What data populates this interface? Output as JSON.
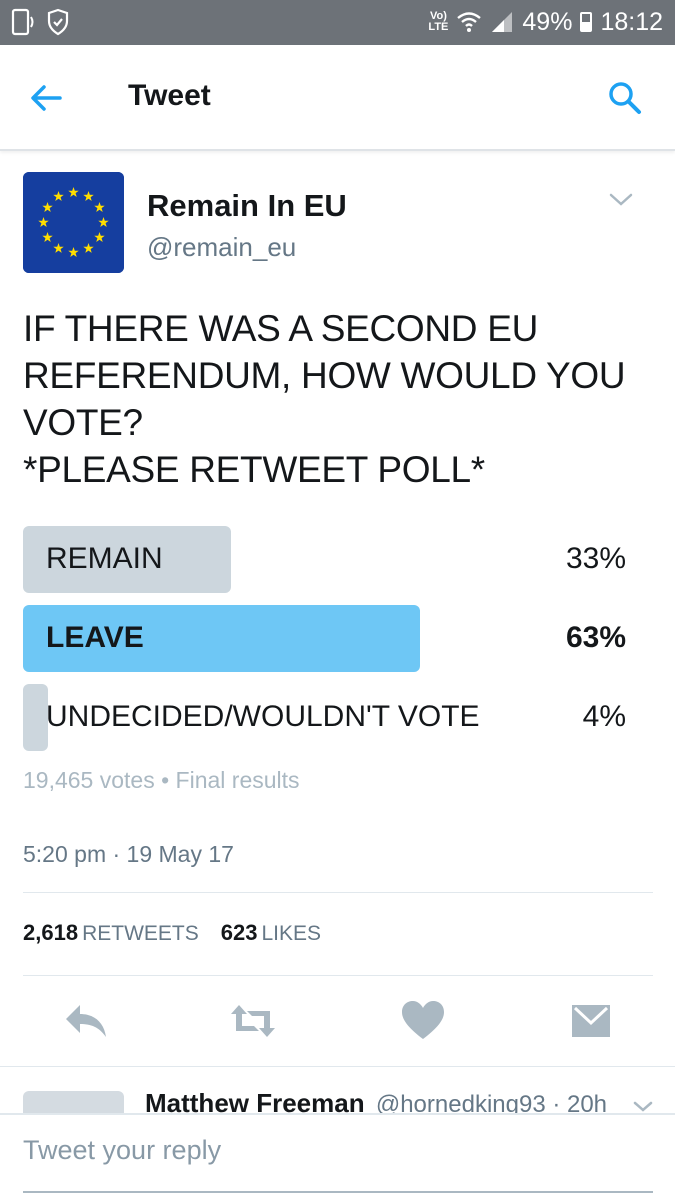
{
  "status_bar": {
    "lte_top": "Vo)",
    "lte_bottom": "LTE",
    "battery": "49%",
    "time": "18:12"
  },
  "header": {
    "title": "Tweet",
    "back_icon": "back-arrow-icon",
    "search_icon": "search-icon"
  },
  "tweet": {
    "author_name": "Remain In EU",
    "author_handle": "@remain_eu",
    "text_lines": [
      "IF THERE WAS A SECOND EU",
      "REFERENDUM, HOW WOULD YOU",
      "VOTE?",
      "*PLEASE RETWEET POLL*"
    ],
    "poll": {
      "options": [
        {
          "label": "REMAIN",
          "percent_text": "33%",
          "percent": 33,
          "winner": false
        },
        {
          "label": "LEAVE",
          "percent_text": "63%",
          "percent": 63,
          "winner": true
        },
        {
          "label": "UNDECIDED/WOULDN'T VOTE",
          "percent_text": "4%",
          "percent": 4,
          "winner": false
        }
      ],
      "meta": "19,465 votes • Final results"
    },
    "timestamp": "5:20 pm · 19 May 17",
    "stats": {
      "retweets_count": "2,618",
      "retweets_label": "RETWEETS",
      "likes_count": "623",
      "likes_label": "LIKES"
    }
  },
  "reply_preview": {
    "name": "Matthew Freeman",
    "handle_time": "@hornedking93 · 20h"
  },
  "reply_box": {
    "placeholder": "Tweet your reply"
  },
  "colors": {
    "accent": "#1da1f2",
    "poll_winner": "#6ec7f5",
    "poll_bar": "#ccd6dd",
    "eu_blue": "#153e9f",
    "eu_star": "#ffdd00"
  }
}
